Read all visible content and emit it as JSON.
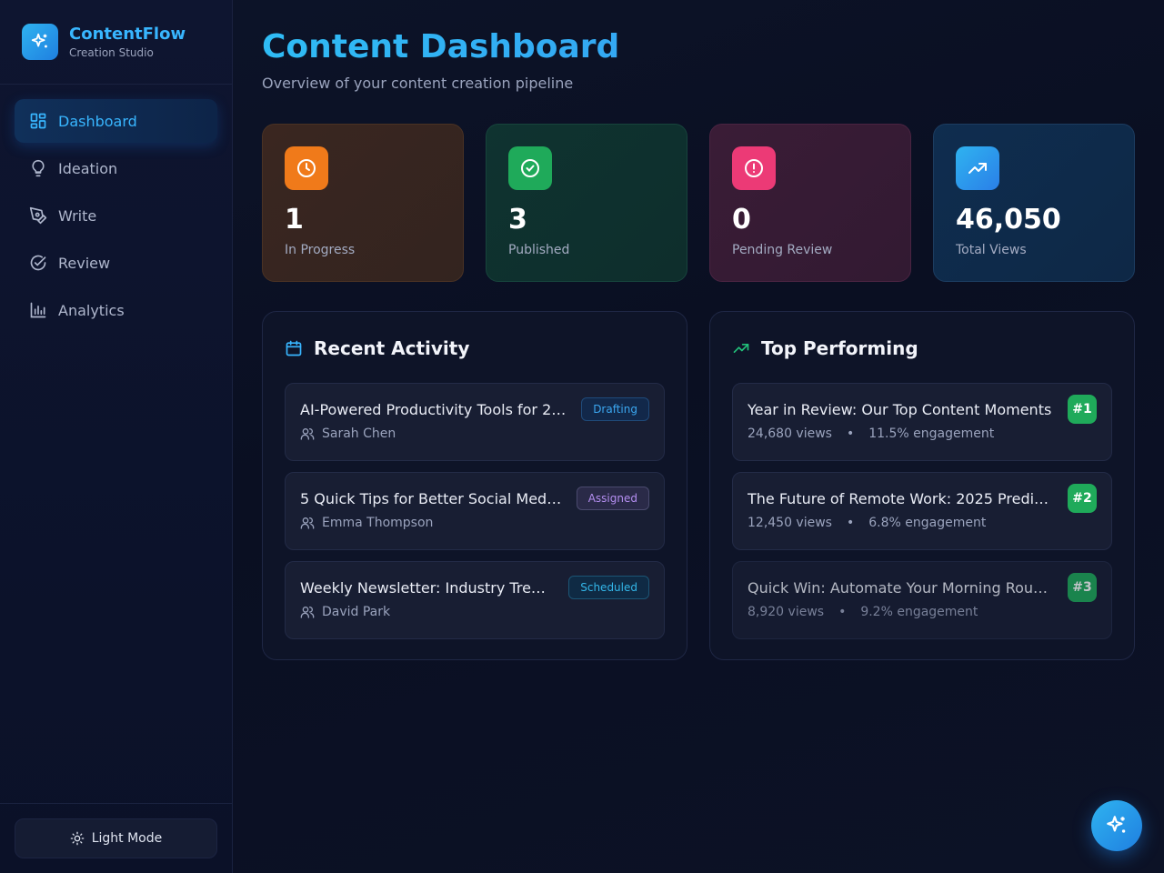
{
  "brand": {
    "name": "ContentFlow",
    "subtitle": "Creation Studio",
    "icon": "sparkles-icon"
  },
  "nav": [
    {
      "label": "Dashboard",
      "icon": "grid-icon",
      "active": true
    },
    {
      "label": "Ideation",
      "icon": "lightbulb-icon"
    },
    {
      "label": "Write",
      "icon": "pen-icon"
    },
    {
      "label": "Review",
      "icon": "check-circle-icon"
    },
    {
      "label": "Analytics",
      "icon": "bar-chart-icon"
    }
  ],
  "theme_toggle": {
    "label": "Light Mode",
    "icon": "sun-icon"
  },
  "header": {
    "title": "Content Dashboard",
    "subtitle": "Overview of your content creation pipeline"
  },
  "stats": [
    {
      "value": "1",
      "label": "In Progress",
      "icon": "clock-icon",
      "color": "#f07a1a"
    },
    {
      "value": "3",
      "label": "Published",
      "icon": "check-circle-icon",
      "color": "#1faa5a"
    },
    {
      "value": "0",
      "label": "Pending Review",
      "icon": "alert-circle-icon",
      "color": "#ec3a76"
    },
    {
      "value": "46,050",
      "label": "Total Views",
      "icon": "trending-up-icon",
      "color": "#2f95f0"
    }
  ],
  "recent_activity": {
    "title": "Recent Activity",
    "icon": "calendar-icon",
    "items": [
      {
        "title": "AI-Powered Productivity Tools for 2…",
        "author": "Sarah Chen",
        "status": "Drafting"
      },
      {
        "title": "5 Quick Tips for Better Social Med…",
        "author": "Emma Thompson",
        "status": "Assigned"
      },
      {
        "title": "Weekly Newsletter: Industry Tre…",
        "author": "David Park",
        "status": "Scheduled"
      }
    ]
  },
  "top_performing": {
    "title": "Top Performing",
    "icon": "trending-up-icon",
    "items": [
      {
        "title": "Year in Review: Our Top Content Moments",
        "views": "24,680 views",
        "engagement": "11.5% engagement",
        "rank": "#1"
      },
      {
        "title": "The Future of Remote Work: 2025 Predi…",
        "views": "12,450 views",
        "engagement": "6.8% engagement",
        "rank": "#2"
      },
      {
        "title": "Quick Win: Automate Your Morning Rou…",
        "views": "8,920 views",
        "engagement": "9.2% engagement",
        "rank": "#3"
      }
    ]
  },
  "separator": "•",
  "fab": {
    "icon": "sparkles-icon"
  }
}
